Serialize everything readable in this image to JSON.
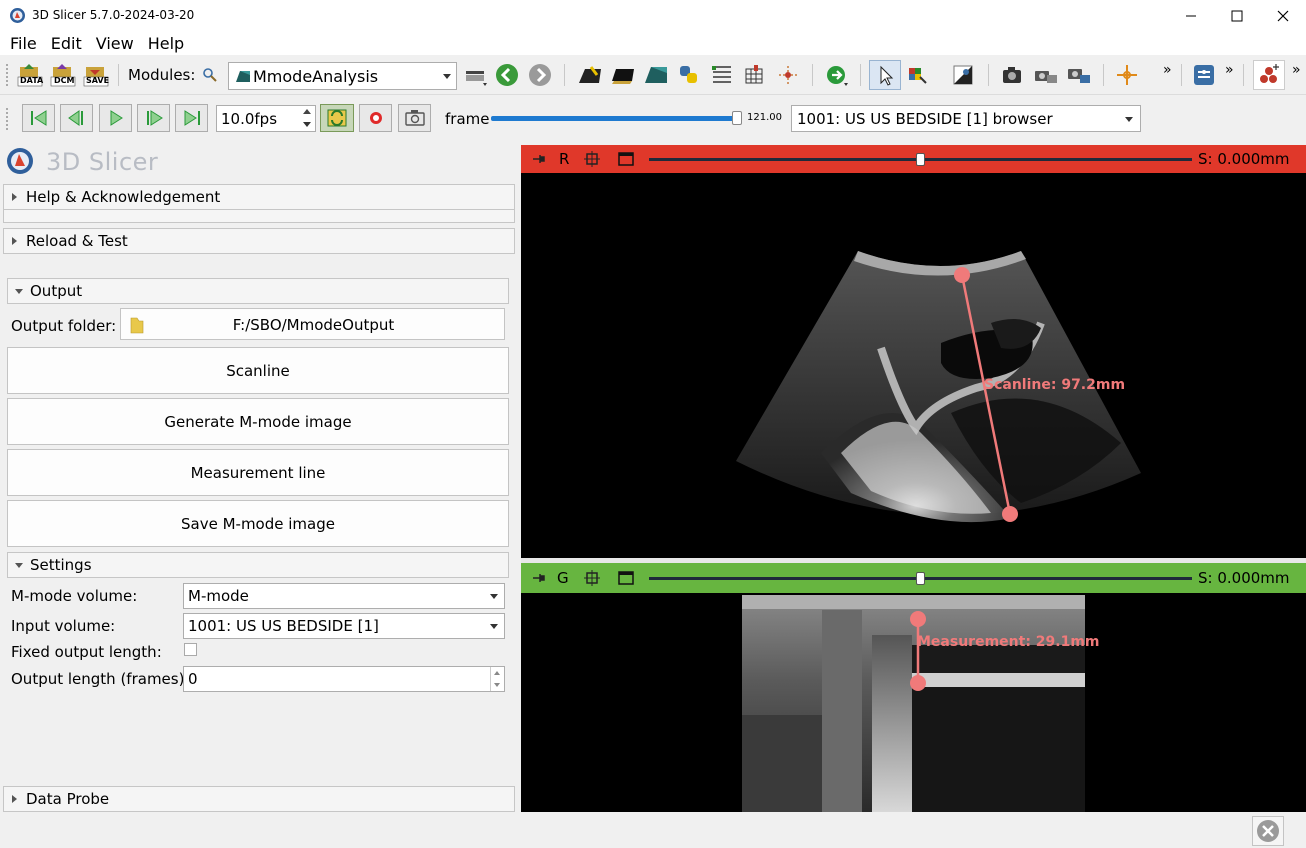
{
  "window": {
    "title": "3D Slicer 5.7.0-2024-03-20"
  },
  "menu": {
    "items": [
      "File",
      "Edit",
      "View",
      "Help"
    ]
  },
  "toolbar": {
    "data_label": "DATA",
    "dcm_label": "DCM",
    "save_label": "SAVE",
    "modules_label": "Modules:",
    "module_selected": "MmodeAnalysis",
    "overflow": "»"
  },
  "sequence": {
    "fps": "10.0fps",
    "frame_label": "frame",
    "frame_max": "121.00",
    "frame_fraction": 1.0,
    "browser": "1001: US US BEDSIDE [1] browser"
  },
  "panel": {
    "logo_text": "3D Slicer",
    "sections": {
      "help": "Help & Acknowledgement",
      "reload": "Reload & Test",
      "output": "Output",
      "settings": "Settings",
      "probe": "Data Probe"
    },
    "output_folder_label": "Output folder:",
    "output_folder_value": "F:/SBO/MmodeOutput",
    "buttons": {
      "scanline": "Scanline",
      "generate": "Generate M-mode image",
      "measurement": "Measurement line",
      "save": "Save M-mode image"
    },
    "settings": {
      "mmode_volume_label": "M-mode volume:",
      "mmode_volume_value": "M-mode",
      "input_volume_label": "Input volume:",
      "input_volume_value": "1001: US US BEDSIDE [1]",
      "fixed_length_label": "Fixed output length:",
      "output_length_label": "Output length (frames):",
      "output_length_value": "0"
    }
  },
  "views": {
    "red": {
      "label": "R",
      "offset": "S: 0.000mm",
      "slider_fraction": 0.5,
      "annotation": "Scanline: 97.2mm"
    },
    "green": {
      "label": "G",
      "offset": "S: 0.000mm",
      "slider_fraction": 0.5,
      "annotation": "Measurement: 29.1mm"
    }
  },
  "colors": {
    "red_view": "#e0382a",
    "green_view": "#67b540",
    "markup": "#f07a7a"
  }
}
